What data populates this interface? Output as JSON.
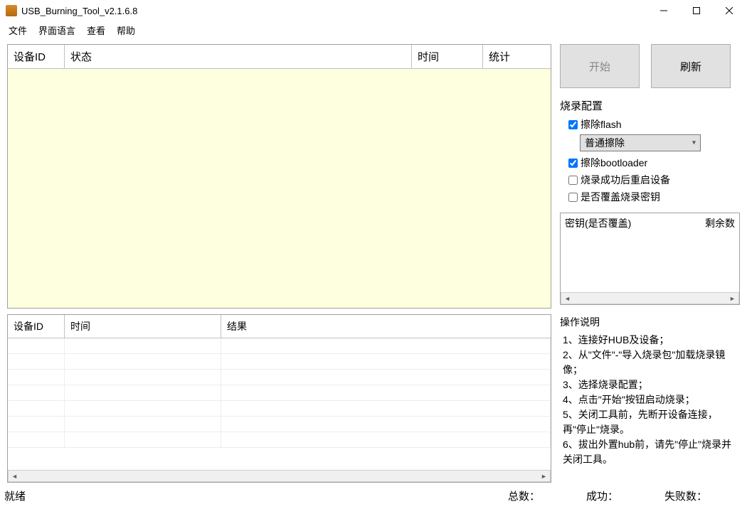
{
  "window": {
    "title": "USB_Burning_Tool_v2.1.6.8"
  },
  "menu": {
    "file": "文件",
    "language": "界面语言",
    "view": "查看",
    "help": "帮助"
  },
  "topGrid": {
    "headers": {
      "deviceId": "设备ID",
      "status": "状态",
      "time": "时间",
      "stats": "统计"
    }
  },
  "bottomGrid": {
    "headers": {
      "deviceId": "设备ID",
      "time": "时间",
      "result": "结果"
    }
  },
  "buttons": {
    "start": "开始",
    "refresh": "刷新"
  },
  "config": {
    "title": "烧录配置",
    "eraseFlash": {
      "label": "擦除flash",
      "checked": true
    },
    "eraseMode": {
      "selected": "普通擦除"
    },
    "eraseBootloader": {
      "label": "擦除bootloader",
      "checked": true
    },
    "rebootAfter": {
      "label": "烧录成功后重启设备",
      "checked": false
    },
    "overwriteKey": {
      "label": "是否覆盖烧录密钥",
      "checked": false
    }
  },
  "keyBox": {
    "col1": "密钥(是否覆盖)",
    "col2": "剩余数"
  },
  "instructions": {
    "title": "操作说明",
    "lines": [
      "1、连接好HUB及设备；",
      "2、从\"文件\"-\"导入烧录包\"加载烧录镜像；",
      "3、选择烧录配置；",
      "4、点击\"开始\"按钮启动烧录；",
      "5、关闭工具前，先断开设备连接，再\"停止\"烧录。",
      "6、拔出外置hub前，请先\"停止\"烧录并关闭工具。"
    ]
  },
  "status": {
    "ready": "就绪",
    "total": "总数：",
    "success": "成功：",
    "fail": "失败数："
  }
}
